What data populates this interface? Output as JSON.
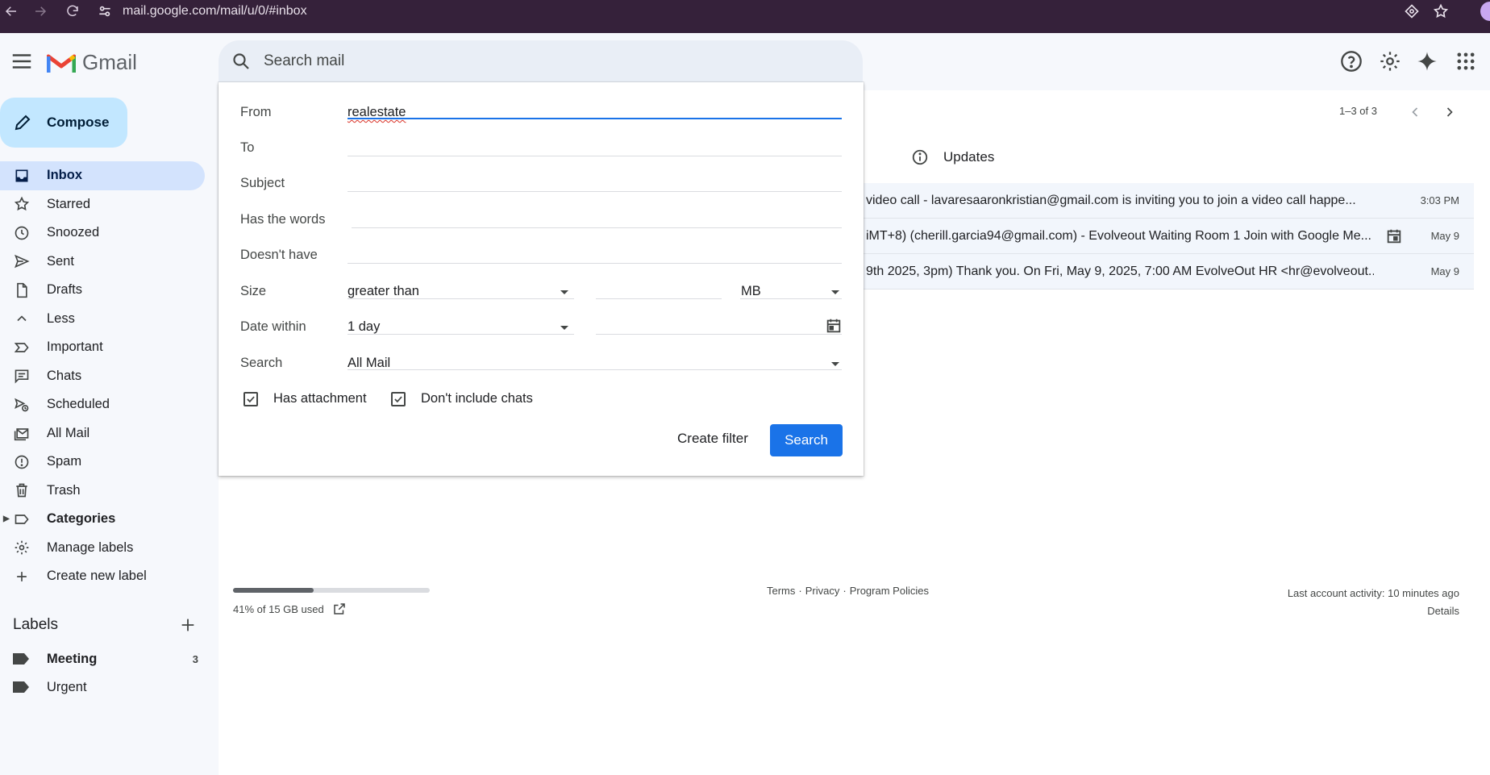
{
  "browser": {
    "url": "mail.google.com/mail/u/0/#inbox"
  },
  "header": {
    "app_name": "Gmail",
    "search_placeholder": "Search mail"
  },
  "sidebar": {
    "compose_label": "Compose",
    "items": [
      {
        "label": "Inbox",
        "icon": "inbox-icon"
      },
      {
        "label": "Starred",
        "icon": "star-icon"
      },
      {
        "label": "Snoozed",
        "icon": "clock-icon"
      },
      {
        "label": "Sent",
        "icon": "send-icon"
      },
      {
        "label": "Drafts",
        "icon": "draft-icon"
      },
      {
        "label": "Less",
        "icon": "chevron-up-icon"
      },
      {
        "label": "Important",
        "icon": "important-icon"
      },
      {
        "label": "Chats",
        "icon": "chat-icon"
      },
      {
        "label": "Scheduled",
        "icon": "scheduled-icon"
      },
      {
        "label": "All Mail",
        "icon": "all-mail-icon"
      },
      {
        "label": "Spam",
        "icon": "spam-icon"
      },
      {
        "label": "Trash",
        "icon": "trash-icon"
      },
      {
        "label": "Categories",
        "icon": "label-outline-icon"
      },
      {
        "label": "Manage labels",
        "icon": "gear-icon"
      },
      {
        "label": "Create new label",
        "icon": "plus-icon"
      }
    ],
    "labels_heading": "Labels",
    "labels": [
      {
        "label": "Meeting",
        "count": "3"
      },
      {
        "label": "Urgent",
        "count": ""
      }
    ]
  },
  "advanced_search": {
    "from_label": "From",
    "from_value": "realestate",
    "to_label": "To",
    "subject_label": "Subject",
    "has_words_label": "Has the words",
    "doesnt_have_label": "Doesn't have",
    "size_label": "Size",
    "size_operator": "greater than",
    "size_unit": "MB",
    "date_within_label": "Date within",
    "date_within_value": "1 day",
    "search_label": "Search",
    "search_scope": "All Mail",
    "has_attachment_label": "Has attachment",
    "has_attachment_checked": true,
    "dont_include_chats_label": "Don't include chats",
    "dont_include_chats_checked": true,
    "create_filter_label": "Create filter",
    "search_button_label": "Search"
  },
  "mail_list": {
    "pager": "1–3 of 3",
    "tab_label": "Updates",
    "rows": [
      {
        "snippet": "video call - lavaresaaronkristian@gmail.com is inviting you to join a video call happe...",
        "time": "3:03 PM"
      },
      {
        "snippet": "iMT+8) (cherill.garcia94@gmail.com) - Evolveout Waiting Room 1 Join with Google Me...",
        "time": "May 9"
      },
      {
        "snippet": "9th 2025, 3pm) Thank you. On Fri, May 9, 2025, 7:00 AM EvolveOut HR <hr@evolveout....",
        "time": "May 9"
      }
    ]
  },
  "footer": {
    "storage_text": "41% of 15 GB used",
    "storage_fraction": 0.41,
    "terms": "Terms",
    "privacy": "Privacy",
    "program_policies": "Program Policies",
    "last_activity": "Last account activity: 10 minutes ago",
    "details": "Details"
  },
  "colors": {
    "accent": "#1a73e8",
    "compose_bg": "#c2e7ff",
    "active_nav_bg": "#d3e3fd",
    "chrome_bg": "#35213a"
  }
}
